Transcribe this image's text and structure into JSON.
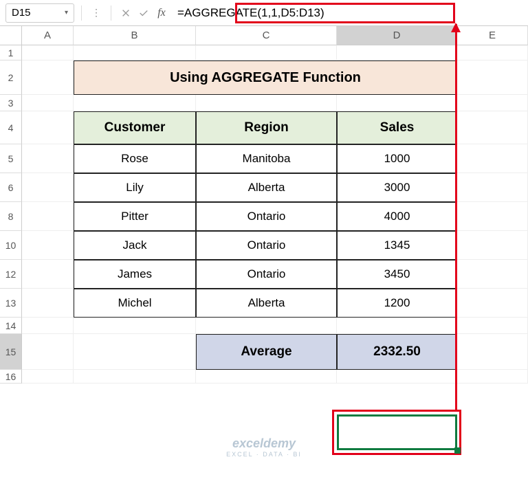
{
  "name_box": "D15",
  "formula": "=AGGREGATE(1,1,D5:D13)",
  "columns": [
    "A",
    "B",
    "C",
    "D",
    "E"
  ],
  "rows": [
    "1",
    "2",
    "3",
    "4",
    "5",
    "6",
    "8",
    "10",
    "12",
    "13",
    "14",
    "15",
    "16"
  ],
  "title": "Using AGGREGATE Function",
  "headers": {
    "customer": "Customer",
    "region": "Region",
    "sales": "Sales"
  },
  "data": [
    {
      "customer": "Rose",
      "region": "Manitoba",
      "sales": "1000"
    },
    {
      "customer": "Lily",
      "region": "Alberta",
      "sales": "3000"
    },
    {
      "customer": "Pitter",
      "region": "Ontario",
      "sales": "4000"
    },
    {
      "customer": "Jack",
      "region": "Ontario",
      "sales": "1345"
    },
    {
      "customer": "James",
      "region": "Ontario",
      "sales": "3450"
    },
    {
      "customer": "Michel",
      "region": "Alberta",
      "sales": "1200"
    }
  ],
  "average_label": "Average",
  "average_value": "2332.50",
  "chart_data": {
    "type": "table",
    "title": "Using AGGREGATE Function",
    "columns": [
      "Customer",
      "Region",
      "Sales"
    ],
    "rows": [
      [
        "Rose",
        "Manitoba",
        1000
      ],
      [
        "Lily",
        "Alberta",
        3000
      ],
      [
        "Pitter",
        "Ontario",
        4000
      ],
      [
        "Jack",
        "Ontario",
        1345
      ],
      [
        "James",
        "Ontario",
        3450
      ],
      [
        "Michel",
        "Alberta",
        1200
      ]
    ],
    "aggregate": {
      "label": "Average",
      "value": 2332.5,
      "formula": "=AGGREGATE(1,1,D5:D13)"
    }
  },
  "watermark": {
    "logo": "exceldemy",
    "sub": "EXCEL · DATA · BI"
  }
}
